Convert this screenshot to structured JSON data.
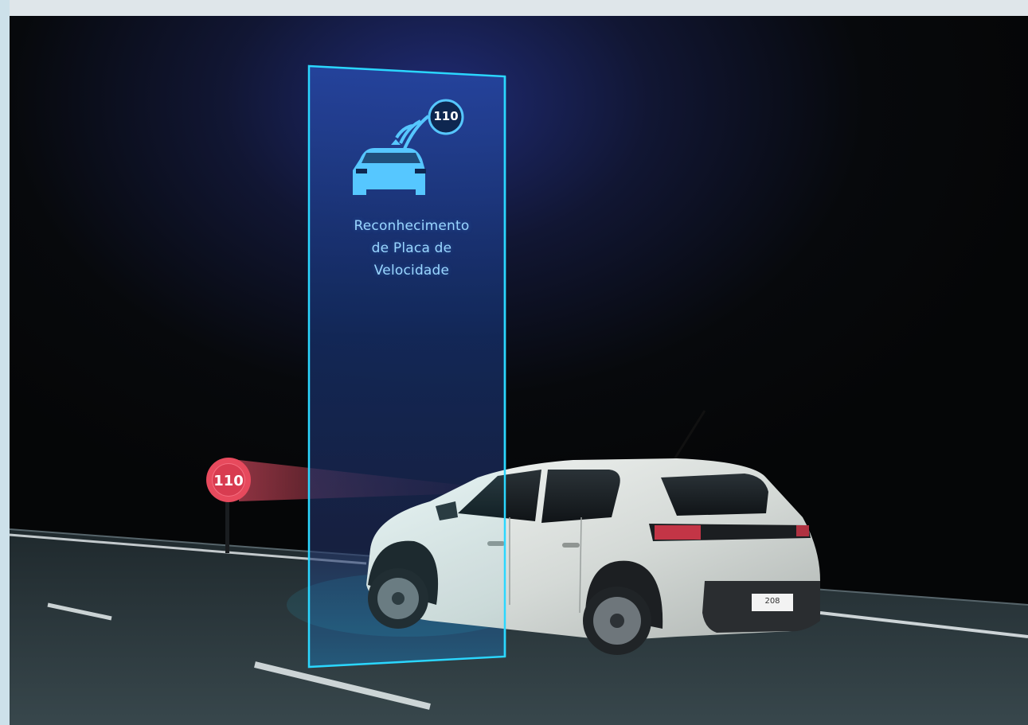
{
  "panel": {
    "title_lines": [
      "Reconhecimento",
      "de Placa de",
      "Velocidade"
    ],
    "badge_speed": "110"
  },
  "road_sign": {
    "speed": "110"
  },
  "car": {
    "plate": "208"
  },
  "colors": {
    "background_night": "#07090c",
    "panel_glow": "#1f2b74",
    "panel_border": "#2bd7ff",
    "icon_blue": "#59c6ff",
    "sign_red": "#e74a5d",
    "car_white": "#e7ece9",
    "road": "#2f3b40"
  },
  "icons": {
    "panel_icon": "car-with-signal-icon"
  }
}
